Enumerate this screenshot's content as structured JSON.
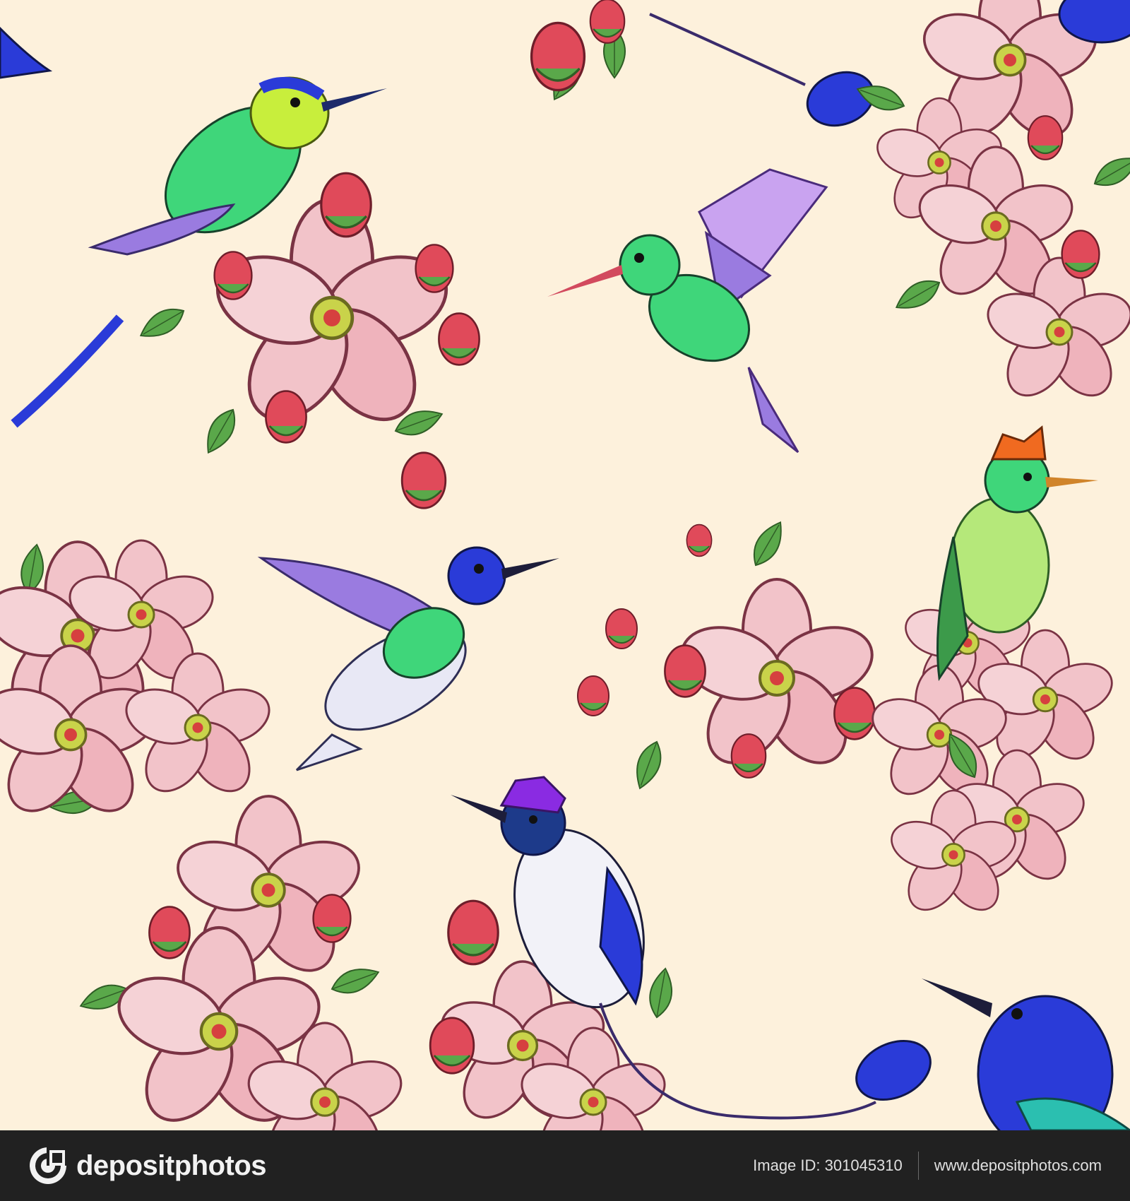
{
  "colors": {
    "background": "#fdf1dc",
    "footer_background": "#212121",
    "blossom_light": "#f2c3c9",
    "blossom_mid": "#e9a0ab",
    "bud_red": "#e04a5a",
    "leaf_green": "#5aa84a",
    "bird_green": "#3fd67a",
    "bird_yellow": "#c8ee3c",
    "bird_blue": "#2a3bd8",
    "bird_violet": "#9a7be0",
    "crest_orange": "#f06a20",
    "crest_purple": "#8a2be2"
  },
  "illustration": {
    "subjects": [
      "hummingbird",
      "apple-blossom"
    ],
    "pattern": "seamless"
  },
  "footer": {
    "brand": "depositphotos",
    "image_id_label": "Image ID:",
    "image_id": "301045310",
    "site": "www.depositphotos.com"
  }
}
